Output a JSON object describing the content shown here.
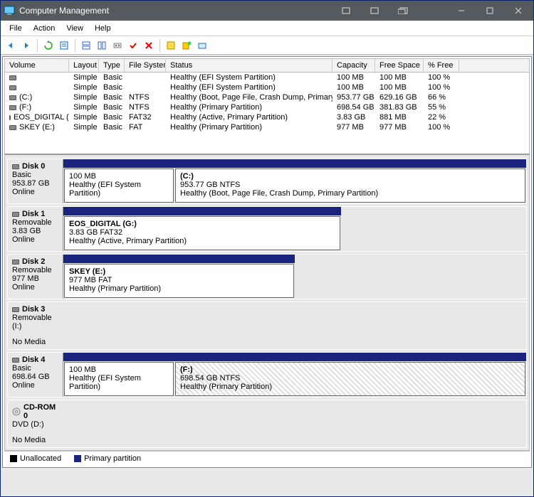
{
  "window": {
    "title": "Computer Management"
  },
  "menu": {
    "file": "File",
    "action": "Action",
    "view": "View",
    "help": "Help"
  },
  "columns": {
    "volume": "Volume",
    "layout": "Layout",
    "type": "Type",
    "fs": "File System",
    "status": "Status",
    "capacity": "Capacity",
    "free": "Free Space",
    "pct": "% Free"
  },
  "volumes": [
    {
      "name": "",
      "layout": "Simple",
      "type": "Basic",
      "fs": "",
      "status": "Healthy (EFI System Partition)",
      "capacity": "100 MB",
      "free": "100 MB",
      "pct": "100 %"
    },
    {
      "name": "",
      "layout": "Simple",
      "type": "Basic",
      "fs": "",
      "status": "Healthy (EFI System Partition)",
      "capacity": "100 MB",
      "free": "100 MB",
      "pct": "100 %"
    },
    {
      "name": "(C:)",
      "layout": "Simple",
      "type": "Basic",
      "fs": "NTFS",
      "status": "Healthy (Boot, Page File, Crash Dump, Primary Partition)",
      "capacity": "953.77 GB",
      "free": "629.16 GB",
      "pct": "66 %"
    },
    {
      "name": "(F:)",
      "layout": "Simple",
      "type": "Basic",
      "fs": "NTFS",
      "status": "Healthy (Primary Partition)",
      "capacity": "698.54 GB",
      "free": "381.83 GB",
      "pct": "55 %"
    },
    {
      "name": "EOS_DIGITAL (G:)",
      "layout": "Simple",
      "type": "Basic",
      "fs": "FAT32",
      "status": "Healthy (Active, Primary Partition)",
      "capacity": "3.83 GB",
      "free": "881 MB",
      "pct": "22 %"
    },
    {
      "name": "SKEY (E:)",
      "layout": "Simple",
      "type": "Basic",
      "fs": "FAT",
      "status": "Healthy (Primary Partition)",
      "capacity": "977 MB",
      "free": "977 MB",
      "pct": "100 %"
    }
  ],
  "disks": {
    "d0": {
      "name": "Disk 0",
      "type": "Basic",
      "size": "953.87 GB",
      "state": "Online",
      "p0": {
        "name": "",
        "size": "100 MB",
        "status": "Healthy (EFI System Partition)"
      },
      "p1": {
        "name": "(C:)",
        "size": "953.77 GB NTFS",
        "status": "Healthy (Boot, Page File, Crash Dump, Primary Partition)"
      }
    },
    "d1": {
      "name": "Disk 1",
      "type": "Removable",
      "size": "3.83 GB",
      "state": "Online",
      "p0": {
        "name": "EOS_DIGITAL  (G:)",
        "size": "3.83 GB FAT32",
        "status": "Healthy (Active, Primary Partition)"
      }
    },
    "d2": {
      "name": "Disk 2",
      "type": "Removable",
      "size": "977 MB",
      "state": "Online",
      "p0": {
        "name": "SKEY  (E:)",
        "size": "977 MB FAT",
        "status": "Healthy (Primary Partition)"
      }
    },
    "d3": {
      "name": "Disk 3",
      "type": "Removable (I:)",
      "size": "",
      "state": "No Media"
    },
    "d4": {
      "name": "Disk 4",
      "type": "Basic",
      "size": "698.64 GB",
      "state": "Online",
      "p0": {
        "name": "",
        "size": "100 MB",
        "status": "Healthy (EFI System Partition)"
      },
      "p1": {
        "name": "(F:)",
        "size": "698.54 GB NTFS",
        "status": "Healthy (Primary Partition)"
      }
    },
    "cd0": {
      "name": "CD-ROM 0",
      "type": "DVD (D:)",
      "size": "",
      "state": "No Media"
    }
  },
  "legend": {
    "unallocated": "Unallocated",
    "primary": "Primary partition"
  }
}
